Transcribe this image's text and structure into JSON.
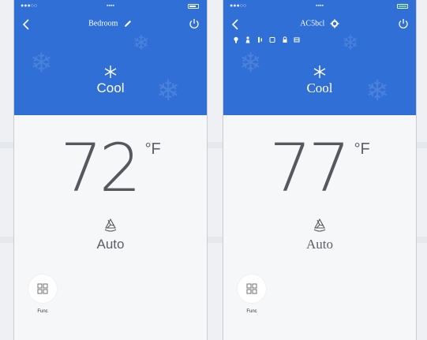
{
  "left_phone": {
    "header": {
      "title": "Bedroom"
    },
    "mode": {
      "label": "Cool"
    },
    "temperature": {
      "value": "72",
      "unit": "°F"
    },
    "fan": {
      "label": "Auto"
    },
    "function": {
      "label": "Func"
    }
  },
  "right_phone": {
    "header": {
      "title": "AC5bcl"
    },
    "mode": {
      "label": "Cool"
    },
    "temperature": {
      "value": "77",
      "unit": "°F"
    },
    "fan": {
      "label": "Auto"
    },
    "function": {
      "label": "Func"
    }
  },
  "colors": {
    "header_blue": "#2f6fd6",
    "background": "#f6f7f9",
    "temperature_text": "#55585e"
  }
}
